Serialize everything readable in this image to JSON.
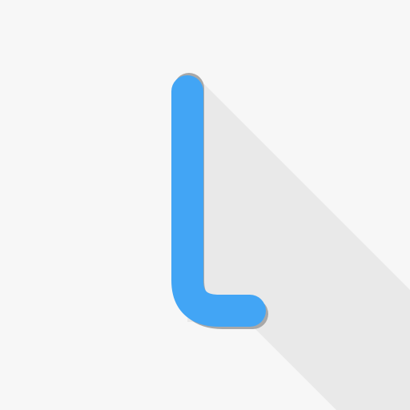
{
  "icon": {
    "glyph": "letter-l-logo",
    "colors": {
      "background": "#f7f7f7",
      "long_shadow": "#e9e9e9",
      "stroke_shadow": "#a8a8a8",
      "stroke": "#42a5f5"
    }
  }
}
